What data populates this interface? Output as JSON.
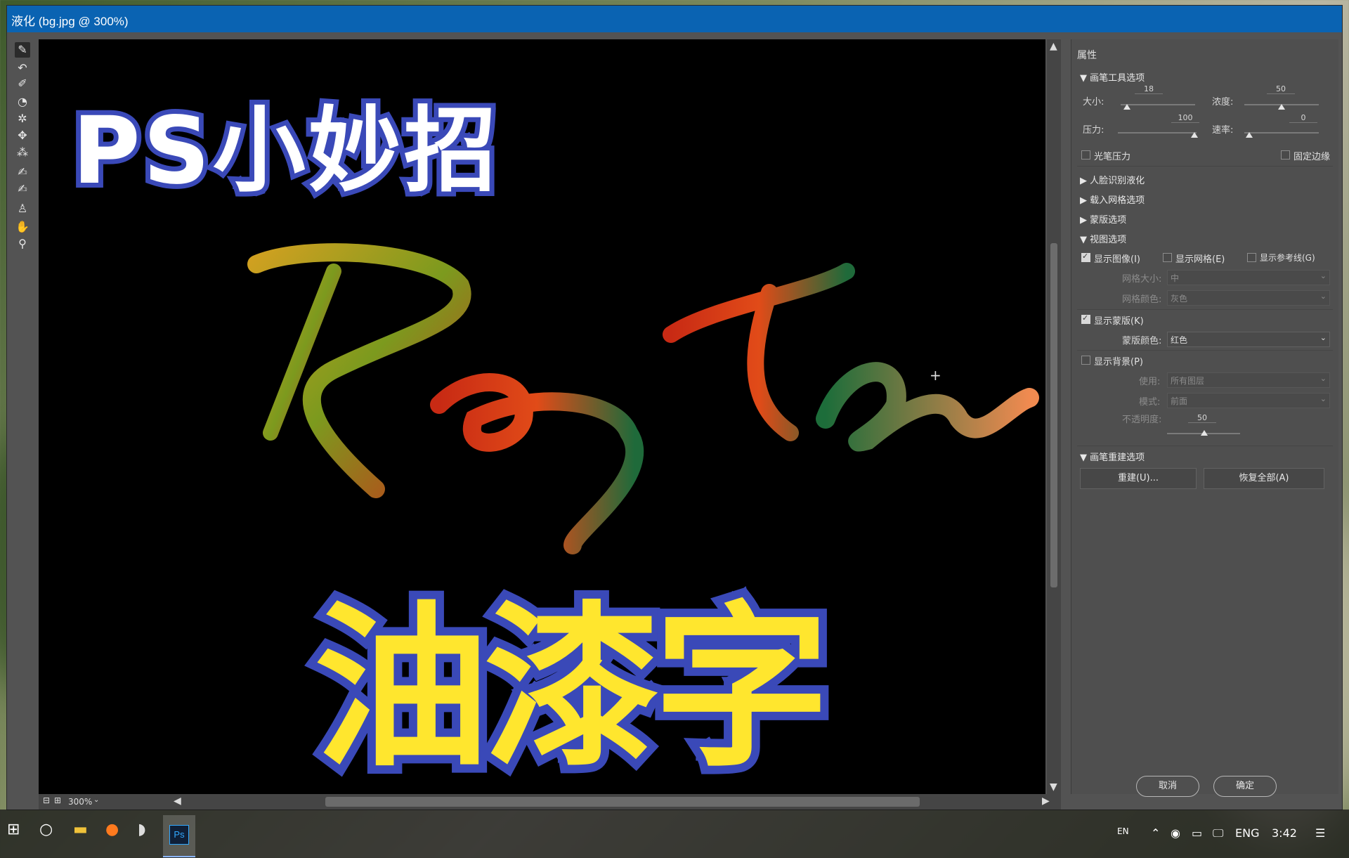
{
  "window": {
    "title": "液化 (bg.jpg @ 300%)"
  },
  "toolbar": {
    "tools": [
      "warp-icon",
      "reconstruct-icon",
      "smooth-icon",
      "twirl-icon",
      "pucker-icon",
      "bloat-icon",
      "push-left-icon",
      "freeze-mask-icon",
      "thaw-mask-icon",
      "face-tool-icon",
      "hand-icon",
      "zoom-icon"
    ]
  },
  "canvas": {
    "brush_text": "Rayten",
    "overlay_title_top": "PS小妙招",
    "overlay_title_bottom": "油漆字"
  },
  "statusbar": {
    "zoom": "300%"
  },
  "panel": {
    "title": "属性",
    "brush_options": {
      "header": "画笔工具选项",
      "size_label": "大小:",
      "size_value": "18",
      "density_label": "浓度:",
      "density_value": "50",
      "pressure_label": "压力:",
      "pressure_value": "100",
      "rate_label": "速率:",
      "rate_value": "0",
      "stylus_pressure_label": "光笔压力",
      "pin_edges_label": "固定边缘"
    },
    "collapsed_sections": [
      "人脸识别液化",
      "载入网格选项",
      "蒙版选项"
    ],
    "view_options": {
      "header": "视图选项",
      "show_image_label": "显示图像(I)",
      "show_mesh_label": "显示网格(E)",
      "show_guides_label": "显示参考线(G)",
      "mesh_size_label": "网格大小:",
      "mesh_size_value": "中",
      "mesh_color_label": "网格颜色:",
      "mesh_color_value": "灰色",
      "show_mask_label": "显示蒙版(K)",
      "mask_color_label": "蒙版颜色:",
      "mask_color_value": "红色",
      "show_backdrop_label": "显示背景(P)",
      "use_label": "使用:",
      "use_value": "所有图层",
      "mode_label": "模式:",
      "mode_value": "前面",
      "opacity_label": "不透明度:",
      "opacity_value": "50"
    },
    "reconstruct": {
      "header": "画笔重建选项",
      "reconstruct_button": "重建(U)...",
      "restore_all_button": "恢复全部(A)"
    },
    "cancel_button": "取消",
    "ok_button": "确定"
  },
  "taskbar": {
    "apps": [
      "windows-start-icon",
      "cortana-icon",
      "file-explorer-icon",
      "firefox-icon",
      "app-icon",
      "photoshop-icon"
    ],
    "photoshop_label": "Ps",
    "ime": "EN",
    "language": "ENG",
    "time": "3:42"
  },
  "colors": {
    "title_blue": "#0a63b2",
    "outline_blue": "#3a49b8",
    "yellow": "#ffe62e"
  }
}
